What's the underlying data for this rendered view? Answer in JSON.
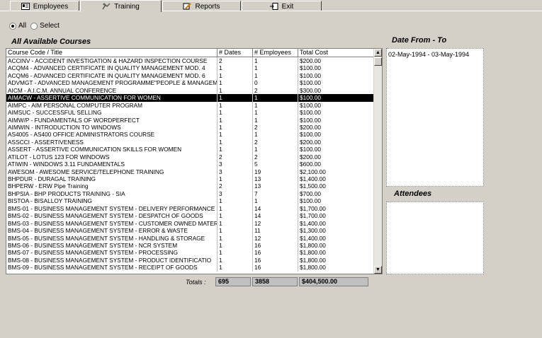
{
  "tabs": [
    {
      "label": "Employees",
      "icon": "employee-card-icon"
    },
    {
      "label": "Training",
      "icon": "training-icon"
    },
    {
      "label": "Reports",
      "icon": "pencil-report-icon"
    },
    {
      "label": "Exit",
      "icon": "exit-door-icon"
    }
  ],
  "filter": {
    "all_label": "All",
    "select_label": "Select",
    "selected": "All"
  },
  "courses_title": "All Available Courses",
  "date_title": "Date From - To",
  "attendees_title": "Attendees",
  "columns": [
    "Course Code /  Title",
    "# Dates",
    "# Employees",
    "Total Cost"
  ],
  "rows": [
    [
      "ACCINV - ACCIDENT INVESTIGATION & HAZARD INSPECTION COURSE",
      "2",
      "1",
      "$200.00"
    ],
    [
      "ACQM4 - ADVANCED CERTIFICATE IN QUALITY MANAGEMENT MOD. 4",
      "1",
      "1",
      "$100.00"
    ],
    [
      "ACQM6 - ADVANCED CERTIFICATE IN QUALITY MANAGEMENT MOD. 6",
      "1",
      "1",
      "$100.00"
    ],
    [
      "ADVMGT - ADVANCED MANAGEMENT PROGRAMME\"PEOPLE & MANAGEMENT\"",
      "1",
      "0",
      "$100.00"
    ],
    [
      "AICM - A.I.C.M. ANNUAL CONFERENCE",
      "1",
      "2",
      "$300.00"
    ],
    [
      "AIMACW - ASSERTIVE COMMUNICATION FOR WOMEN",
      "1",
      "1",
      "$100.00"
    ],
    [
      "AIMPC - AIM PERSONAL COMPUTER PROGRAM",
      "1",
      "1",
      "$100.00"
    ],
    [
      "AIMSUC - SUCCESSFUL SELLING",
      "1",
      "1",
      "$100.00"
    ],
    [
      "AIMW/P - FUNDAMENTALS OF WORDPERFECT",
      "1",
      "1",
      "$100.00"
    ],
    [
      "AIMWIN - INTRODUCTION TO WINDOWS",
      "1",
      "2",
      "$200.00"
    ],
    [
      "AS4005 - AS400 OFFICE ADMINISTRATORS COURSE",
      "1",
      "1",
      "$100.00"
    ],
    [
      "ASSCCI - ASSERTIVENESS",
      "1",
      "2",
      "$200.00"
    ],
    [
      "ASSERT - ASSERTIVE COMMUNICATION SKILLS FOR WOMEN",
      "1",
      "1",
      "$100.00"
    ],
    [
      "ATILOT - LOTUS 123 FOR WINDOWS",
      "2",
      "2",
      "$200.00"
    ],
    [
      "ATIWIN - WINDOWS 3.11 FUNDAMENTALS",
      "3",
      "5",
      "$600.00"
    ],
    [
      "AWESOM - AWESOME SERVICE/TELEPHONE TRAINING",
      "3",
      "19",
      "$2,100.00"
    ],
    [
      "BHPDUR - DURAGAL TRAINING",
      "1",
      "13",
      "$1,400.00"
    ],
    [
      "BHPERW - ERW Pipe Training",
      "2",
      "13",
      "$1,500.00"
    ],
    [
      "BHPSIA - BHP PRODUCTS TRAINING - SIA",
      "3",
      "7",
      "$700.00"
    ],
    [
      "BISTOA - BISALLOY TRAINING",
      "1",
      "1",
      "$100.00"
    ],
    [
      "BMS-01 - BUSINESS MANAGEMENT SYSTEM - DELIVERY PERFORMANCE",
      "1",
      "14",
      "$1,700.00"
    ],
    [
      "BMS-02 - BUSINESS MANAGEMENT SYSTEM - DESPATCH OF GOODS",
      "1",
      "14",
      "$1,700.00"
    ],
    [
      "BMS-03 - BUSINESS MANAGEMENT SYSTEM - CUSTOMER OWNED MATERI",
      "1",
      "12",
      "$1,400.00"
    ],
    [
      "BMS-04 - BUSINESS MANAGEMENT SYSTEM - ERROR & WASTE",
      "1",
      "11",
      "$1,300.00"
    ],
    [
      "BMS-05 - BUSINESS MANAGEMENT SYSTEM - HANDLING & STORAGE",
      "1",
      "12",
      "$1,400.00"
    ],
    [
      "BMS-06 - BUSINESS MANAGEMENT SYSTEM - NCR SYSTEM",
      "1",
      "16",
      "$1,800.00"
    ],
    [
      "BMS-07 - BUSINESS MANAGEMENT SYSTEM - PROCESSING",
      "1",
      "16",
      "$1,800.00"
    ],
    [
      "BMS-08 - BUSINESS MANAGEMENT SYSTEM - PRODUCT IDENTIFICATIO",
      "1",
      "16",
      "$1,800.00"
    ],
    [
      "BMS-09 - BUSINESS MANAGEMENT SYSTEM - RECEIPT OF GOODS",
      "1",
      "16",
      "$1,800.00"
    ]
  ],
  "selected_row": 5,
  "totals": {
    "label": "Totals :",
    "dates": "695",
    "employees": "3858",
    "cost": "$404,500.00"
  },
  "date_ranges": [
    "02-May-1994 - 03-May-1994"
  ]
}
